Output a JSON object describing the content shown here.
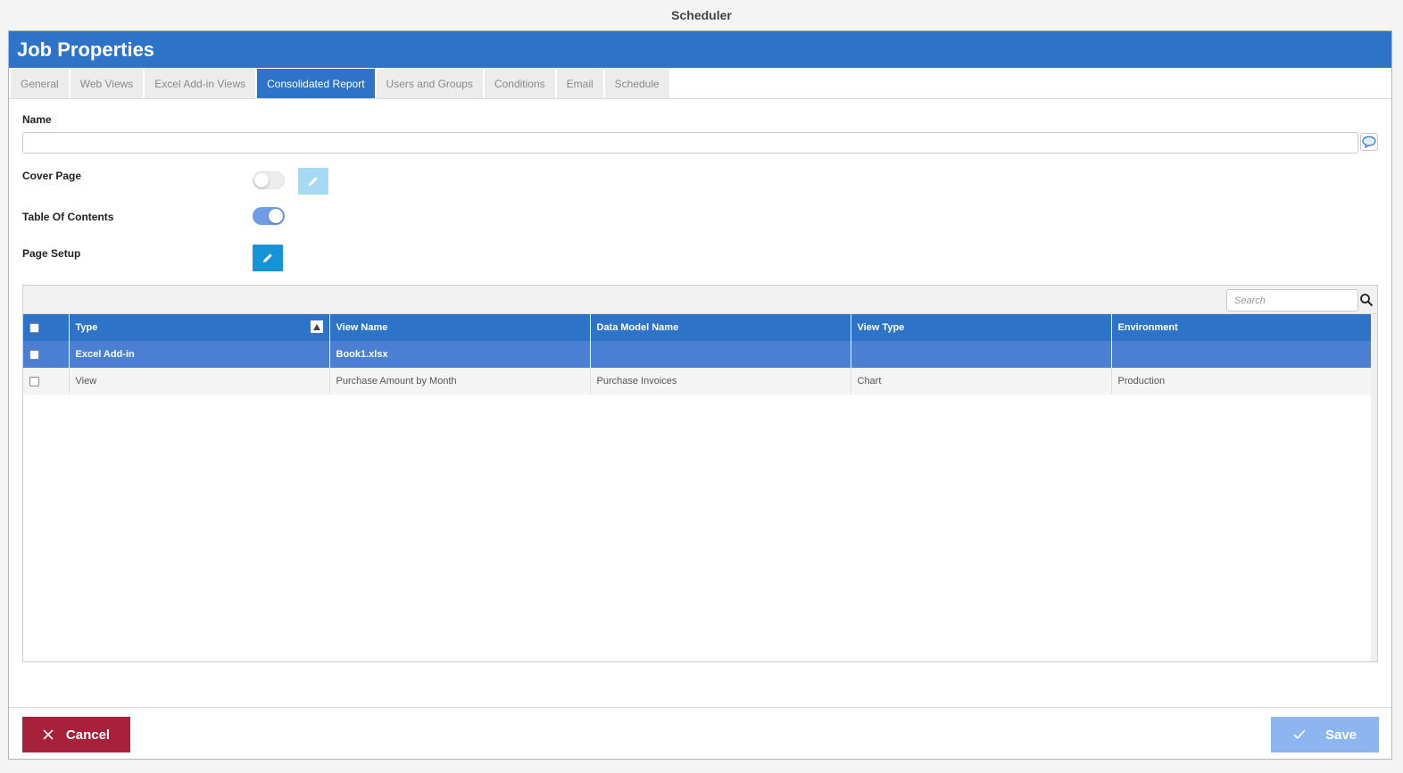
{
  "app": {
    "title": "Scheduler"
  },
  "dialog": {
    "title": "Job Properties"
  },
  "tabs": [
    {
      "label": "General",
      "active": false
    },
    {
      "label": "Web Views",
      "active": false
    },
    {
      "label": "Excel Add-in Views",
      "active": false
    },
    {
      "label": "Consolidated Report",
      "active": true
    },
    {
      "label": "Users and Groups",
      "active": false
    },
    {
      "label": "Conditions",
      "active": false
    },
    {
      "label": "Email",
      "active": false
    },
    {
      "label": "Schedule",
      "active": false
    }
  ],
  "form": {
    "name_label": "Name",
    "name_value": "",
    "cover_page_label": "Cover Page",
    "cover_page_enabled": false,
    "toc_label": "Table Of Contents",
    "toc_enabled": true,
    "page_setup_label": "Page Setup"
  },
  "grid": {
    "search_placeholder": "Search",
    "columns": [
      "Type",
      "View Name",
      "Data Model Name",
      "View Type",
      "Environment"
    ],
    "rows": [
      {
        "type": "Excel Add-in",
        "view_name": "Book1.xlsx",
        "data_model": "",
        "view_type": "",
        "environment": "",
        "selected": true
      },
      {
        "type": "View",
        "view_name": "Purchase Amount by Month",
        "data_model": "Purchase Invoices",
        "view_type": "Chart",
        "environment": "Production",
        "selected": false
      }
    ]
  },
  "footer": {
    "cancel_label": "Cancel",
    "save_label": "Save"
  },
  "colors": {
    "primary": "#2d74c8",
    "danger": "#a8213a",
    "save_disabled": "#8db5ef",
    "edit_button": "#1595d8"
  },
  "icons": {
    "comment": "comment-icon",
    "edit": "pencil-icon",
    "search": "search-icon",
    "sort": "sort-asc-icon",
    "cancel": "close-icon",
    "save": "check-icon"
  }
}
